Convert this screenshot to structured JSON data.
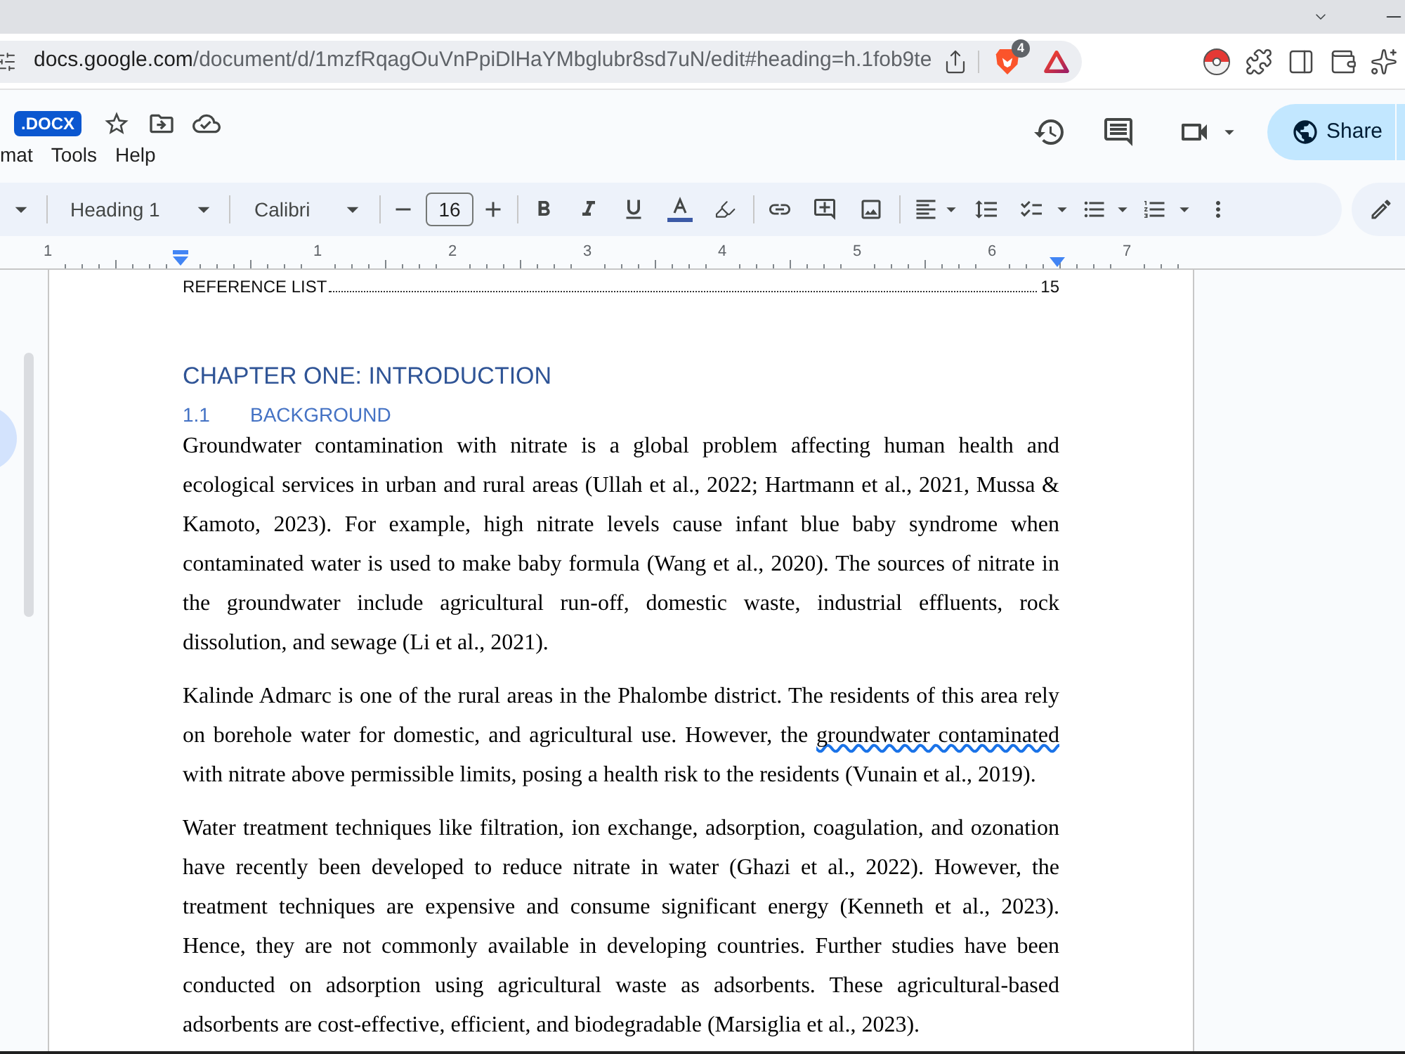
{
  "browser": {
    "url_host": "docs.google.com",
    "url_path": "/document/d/1mzfRqagOuVnPpiDlHaYMbglubr8sd7uN/edit#heading=h.1fob9te",
    "extension_badge": "4"
  },
  "docs_header": {
    "file_badge": ".DOCX",
    "menu": [
      "mat",
      "Tools",
      "Help"
    ],
    "share_label": "Share"
  },
  "toolbar": {
    "paragraph_style": {
      "value": "Heading 1"
    },
    "typeface_picker": {
      "value": "Calibri"
    },
    "size_field": {
      "value": "16"
    }
  },
  "ruler": {
    "labels": [
      "1",
      "1",
      "2",
      "3",
      "4",
      "5",
      "6",
      "7"
    ]
  },
  "document": {
    "toc_entry": {
      "title": "REFERENCE LIST",
      "page": "15"
    },
    "chapter_heading": "CHAPTER ONE: INTRODUCTION",
    "section_heading": {
      "number": "1.1",
      "title": "BACKGROUND"
    },
    "paragraphs": [
      {
        "runs": [
          {
            "text": "Groundwater contamination with nitrate is a global problem affecting human health and ecological services in urban and rural areas (Ullah et al., 2022; Hartmann et al., 2021, Mussa & Kamoto, 2023). For example, high nitrate levels cause infant blue baby syndrome when contaminated water is used to make baby formula (Wang et al., 2020). The sources of nitrate in the groundwater include agricultural run-off, domestic waste, industrial effluents, rock dissolution, and sewage (Li et al., 2021).",
            "grammar_flagged": false
          }
        ]
      },
      {
        "runs": [
          {
            "text": "Kalinde Admarc is one of the rural areas in the Phalombe district. The residents of this area rely on borehole water for domestic, and agricultural use. However, the ",
            "grammar_flagged": false
          },
          {
            "text": "groundwater contaminated",
            "grammar_flagged": true
          },
          {
            "text": " with nitrate above permissible limits, posing a health risk to the residents (Vunain et al., 2019).",
            "grammar_flagged": false
          }
        ]
      },
      {
        "runs": [
          {
            "text": "Water treatment techniques like filtration, ion exchange, adsorption, coagulation, and ozonation have recently been developed to reduce nitrate in water (Ghazi et al., 2022). However, the treatment techniques are expensive and consume significant energy (Kenneth et al., 2023). Hence, they are not commonly available in developing countries. Further studies have been conducted on adsorption using agricultural waste as adsorbents. These agricultural-based adsorbents are cost-effective, efficient, and biodegradable (Marsiglia et al., 2023).",
            "grammar_flagged": false
          }
        ]
      }
    ]
  }
}
